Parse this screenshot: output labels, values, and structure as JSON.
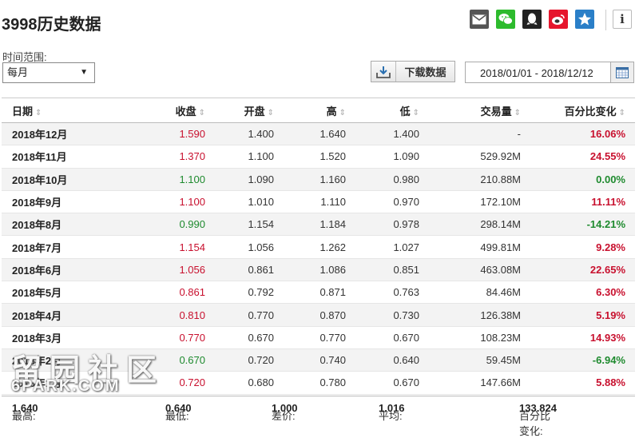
{
  "title": "3998历史数据",
  "share_icons": [
    "mail-icon",
    "wechat-icon",
    "qq-icon",
    "weibo-icon",
    "star-icon"
  ],
  "info_glyph": "i",
  "range": {
    "label": "时间范围:",
    "selected": "每月"
  },
  "download_label": "下载数据",
  "date_range": "2018/01/01 - 2018/12/12",
  "columns": [
    "日期",
    "收盘",
    "开盘",
    "高",
    "低",
    "交易量",
    "百分比变化"
  ],
  "rows": [
    {
      "date": "2018年12月",
      "close": "1.590",
      "open": "1.400",
      "high": "1.640",
      "low": "1.400",
      "volume": "-",
      "change": "16.06%",
      "close_dir": "up",
      "change_dir": "up"
    },
    {
      "date": "2018年11月",
      "close": "1.370",
      "open": "1.100",
      "high": "1.520",
      "low": "1.090",
      "volume": "529.92M",
      "change": "24.55%",
      "close_dir": "up",
      "change_dir": "up"
    },
    {
      "date": "2018年10月",
      "close": "1.100",
      "open": "1.090",
      "high": "1.160",
      "low": "0.980",
      "volume": "210.88M",
      "change": "0.00%",
      "close_dir": "down",
      "change_dir": "down"
    },
    {
      "date": "2018年9月",
      "close": "1.100",
      "open": "1.010",
      "high": "1.110",
      "low": "0.970",
      "volume": "172.10M",
      "change": "11.11%",
      "close_dir": "up",
      "change_dir": "up"
    },
    {
      "date": "2018年8月",
      "close": "0.990",
      "open": "1.154",
      "high": "1.184",
      "low": "0.978",
      "volume": "298.14M",
      "change": "-14.21%",
      "close_dir": "down",
      "change_dir": "down"
    },
    {
      "date": "2018年7月",
      "close": "1.154",
      "open": "1.056",
      "high": "1.262",
      "low": "1.027",
      "volume": "499.81M",
      "change": "9.28%",
      "close_dir": "up",
      "change_dir": "up"
    },
    {
      "date": "2018年6月",
      "close": "1.056",
      "open": "0.861",
      "high": "1.086",
      "low": "0.851",
      "volume": "463.08M",
      "change": "22.65%",
      "close_dir": "up",
      "change_dir": "up"
    },
    {
      "date": "2018年5月",
      "close": "0.861",
      "open": "0.792",
      "high": "0.871",
      "low": "0.763",
      "volume": "84.46M",
      "change": "6.30%",
      "close_dir": "up",
      "change_dir": "up"
    },
    {
      "date": "2018年4月",
      "close": "0.810",
      "open": "0.770",
      "high": "0.870",
      "low": "0.730",
      "volume": "126.38M",
      "change": "5.19%",
      "close_dir": "up",
      "change_dir": "up"
    },
    {
      "date": "2018年3月",
      "close": "0.770",
      "open": "0.670",
      "high": "0.770",
      "low": "0.670",
      "volume": "108.23M",
      "change": "14.93%",
      "close_dir": "up",
      "change_dir": "up"
    },
    {
      "date": "2018年2月",
      "close": "0.670",
      "open": "0.720",
      "high": "0.740",
      "low": "0.640",
      "volume": "59.45M",
      "change": "-6.94%",
      "close_dir": "down",
      "change_dir": "down"
    },
    {
      "date": "2018年1月",
      "close": "0.720",
      "open": "0.680",
      "high": "0.780",
      "low": "0.670",
      "volume": "147.66M",
      "change": "5.88%",
      "close_dir": "up",
      "change_dir": "up"
    }
  ],
  "summary": {
    "high_label": "最高:",
    "high": "1.640",
    "low_label": "最低:",
    "low": "0.640",
    "diff_label": "差价:",
    "diff": "1.000",
    "avg_label": "平均:",
    "avg": "1.016",
    "pct_label": "百分比变化:",
    "pct": "133.824"
  },
  "watermark": {
    "line1": "留园社区",
    "line2": "6PARK.COM"
  },
  "colors": {
    "up": "#c8102e",
    "down": "#1e8a2e"
  }
}
